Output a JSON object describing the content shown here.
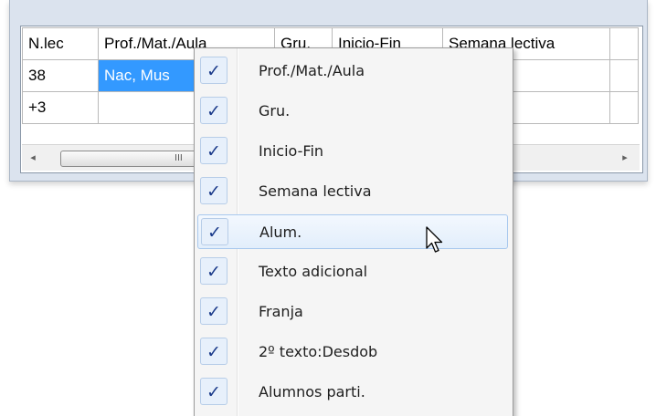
{
  "grid": {
    "columns": [
      "N.lec",
      "Prof./Mat./Aula",
      "Gru.",
      "Inicio-Fin",
      "Semana lectiva"
    ],
    "rows": [
      {
        "n_lec": "38",
        "prof": "Nac, Mus"
      },
      {
        "n_lec": "+3",
        "prof": ""
      }
    ]
  },
  "scrollbar": {
    "left_arrow": "◂",
    "right_arrow": "▸",
    "grip": "III"
  },
  "context_menu": {
    "check_glyph": "✓",
    "items": [
      {
        "label": "Prof./Mat./Aula",
        "checked": true
      },
      {
        "label": "Gru.",
        "checked": true
      },
      {
        "label": "Inicio-Fin",
        "checked": true
      },
      {
        "label": "Semana lectiva",
        "checked": true
      },
      {
        "label": "Alum.",
        "checked": true,
        "hovered": true
      },
      {
        "label": "Texto adicional",
        "checked": true
      },
      {
        "label": "Franja",
        "checked": true
      },
      {
        "label": "2º texto:Desdob",
        "checked": true
      },
      {
        "label": "Alumnos parti.",
        "checked": true
      }
    ]
  },
  "colors": {
    "selection": "#3399ff",
    "menu_background": "#f5f5f5",
    "check_color": "#1a3a8a",
    "hover_border": "#a8c8ee"
  }
}
